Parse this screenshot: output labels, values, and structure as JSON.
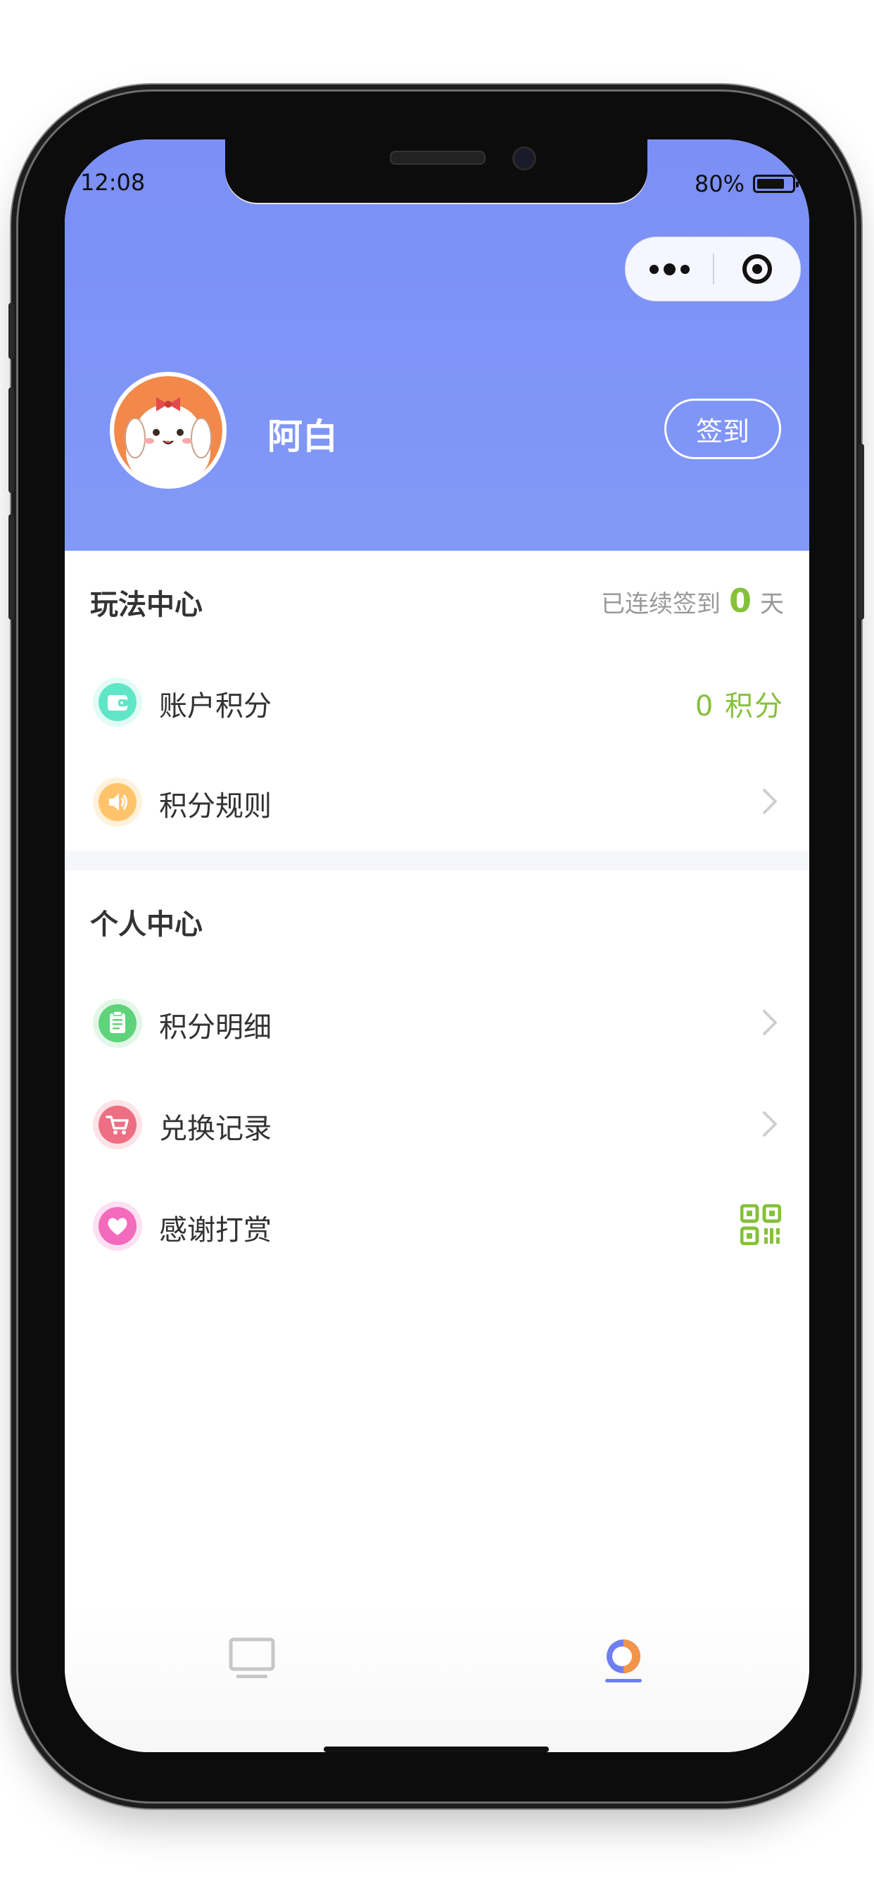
{
  "status_bar": {
    "time": "12:08",
    "battery": "80%"
  },
  "profile": {
    "name": "阿白",
    "signin_label": "签到"
  },
  "play_center": {
    "title": "玩法中心",
    "streak": {
      "prefix": "已连续签到",
      "days": "0",
      "suffix": "天"
    },
    "items": [
      {
        "label": "账户积分",
        "value": "0 积分",
        "icon": "wallet-icon",
        "color": "#5ee6c6"
      },
      {
        "label": "积分规则",
        "icon": "speaker-icon",
        "color": "#ffc46b"
      }
    ]
  },
  "personal_center": {
    "title": "个人中心",
    "items": [
      {
        "label": "积分明细",
        "icon": "clipboard-icon",
        "color": "#5fd37a"
      },
      {
        "label": "兑换记录",
        "icon": "cart-icon",
        "color": "#ec6f83"
      },
      {
        "label": "感谢打赏",
        "icon": "heart-icon",
        "color": "#f26bbd"
      }
    ]
  },
  "tabs": [
    {
      "name": "home",
      "icon": "monitor-icon",
      "active": false
    },
    {
      "name": "me",
      "icon": "profile-icon",
      "active": true
    }
  ],
  "colors": {
    "header": "#7b8ff6",
    "accent_green": "#86c13b",
    "tab_active": "#6f7ff2"
  }
}
